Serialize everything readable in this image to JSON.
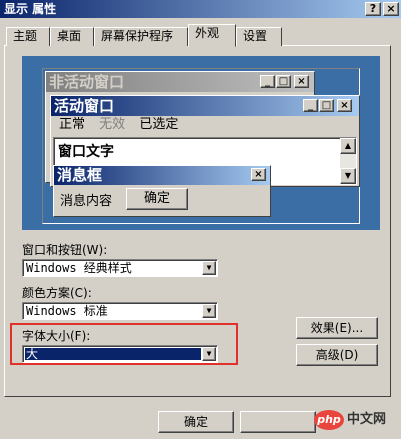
{
  "window": {
    "title": "显示 属性",
    "help_btn": "?",
    "close_btn": "×"
  },
  "tabs": [
    {
      "label": "主题",
      "active": false
    },
    {
      "label": "桌面",
      "active": false
    },
    {
      "label": "屏幕保护程序",
      "active": false
    },
    {
      "label": "外观",
      "active": true
    },
    {
      "label": "设置",
      "active": false
    }
  ],
  "preview": {
    "inactive_title": "非活动窗口",
    "active_title": "活动窗口",
    "menu": {
      "normal": "正常",
      "disabled": "无效",
      "selected": "已选定"
    },
    "window_text": "窗口文字",
    "msgbox_title": "消息框",
    "msgbox_content": "消息内容",
    "msgbox_ok": "确定",
    "btn_min": "_",
    "btn_max": "□",
    "btn_close": "×"
  },
  "form": {
    "window_buttons_label": "窗口和按钮(W):",
    "window_buttons_value": "Windows 经典样式",
    "color_scheme_label": "颜色方案(C):",
    "color_scheme_value": "Windows 标准",
    "font_size_label": "字体大小(F):",
    "font_size_value": "大",
    "effects_button": "效果(E)...",
    "advanced_button": "高级(D)"
  },
  "footer": {
    "ok_button": "确定"
  },
  "watermark": {
    "logo": "php",
    "text": "中文网"
  },
  "colors": {
    "highlight_border": "#e0302a",
    "active_caption": "#0a246a",
    "desktop": "#3a6ea5"
  }
}
